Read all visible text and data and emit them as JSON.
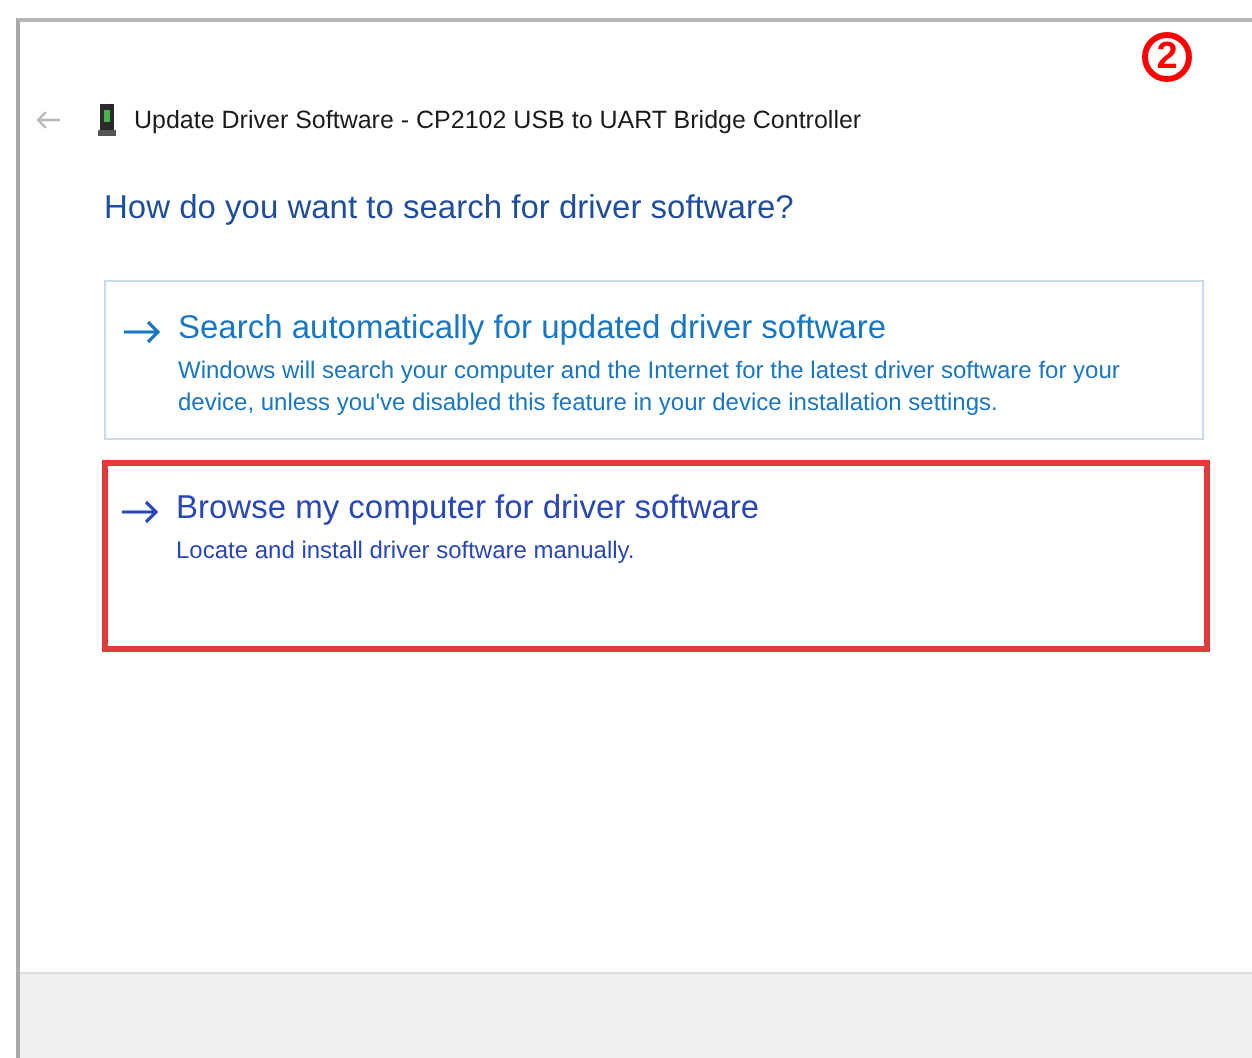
{
  "step_badge": "2",
  "window": {
    "title": "Update Driver Software - CP2102 USB to UART Bridge Controller"
  },
  "heading": "How do you want to search for driver software?",
  "options": [
    {
      "title": "Search automatically for updated driver software",
      "description": "Windows will search your computer and the Internet for the latest driver software for your device, unless you've disabled this feature in your device installation settings.",
      "highlighted": false
    },
    {
      "title": "Browse my computer for driver software",
      "description": "Locate and install driver software manually.",
      "highlighted": true
    }
  ]
}
